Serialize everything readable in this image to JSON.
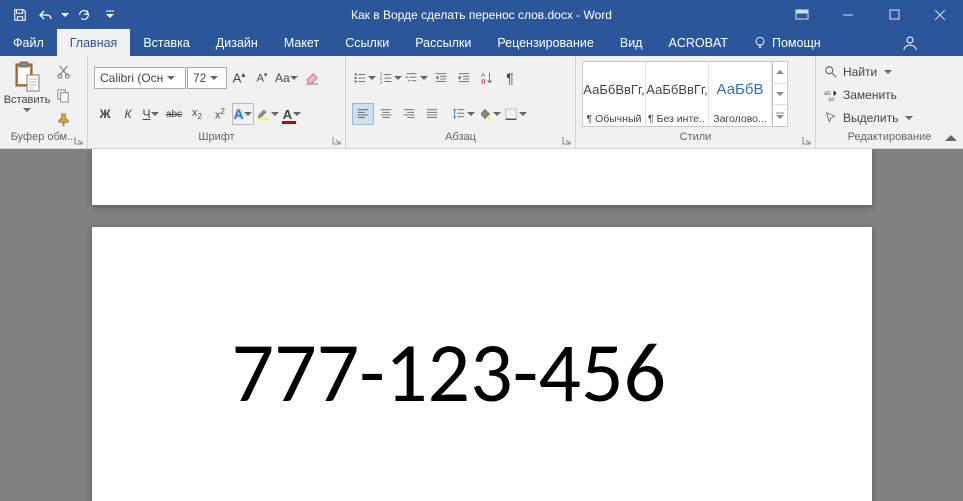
{
  "title": "Как в Ворде сделать перенос слов.docx - Word",
  "tabs": {
    "file": "Файл",
    "home": "Главная",
    "insert": "Вставка",
    "design": "Дизайн",
    "layout": "Макет",
    "references": "Ссылки",
    "mailings": "Рассылки",
    "review": "Рецензирование",
    "view": "Вид",
    "acrobat": "ACROBAT",
    "help": "Помощн"
  },
  "clipboard": {
    "paste": "Вставить",
    "group_label": "Буфер обм..."
  },
  "font": {
    "family": "Calibri (Осн",
    "size": "72",
    "bold": "Ж",
    "italic": "К",
    "underline": "Ч",
    "strike": "abc",
    "caps": "Aa",
    "group_label": "Шрифт"
  },
  "paragraph": {
    "group_label": "Абзац"
  },
  "styles": {
    "items": [
      {
        "preview": "АаБбВвГг,",
        "name": "¶ Обычный"
      },
      {
        "preview": "АаБбВвГг,",
        "name": "¶ Без инте..."
      },
      {
        "preview": "АаБбВ",
        "name": "Заголово..."
      }
    ],
    "group_label": "Стили"
  },
  "editing": {
    "find": "Найти",
    "replace": "Заменить",
    "select": "Выделить",
    "group_label": "Редактирование"
  },
  "document": {
    "content": "777-123-456"
  }
}
